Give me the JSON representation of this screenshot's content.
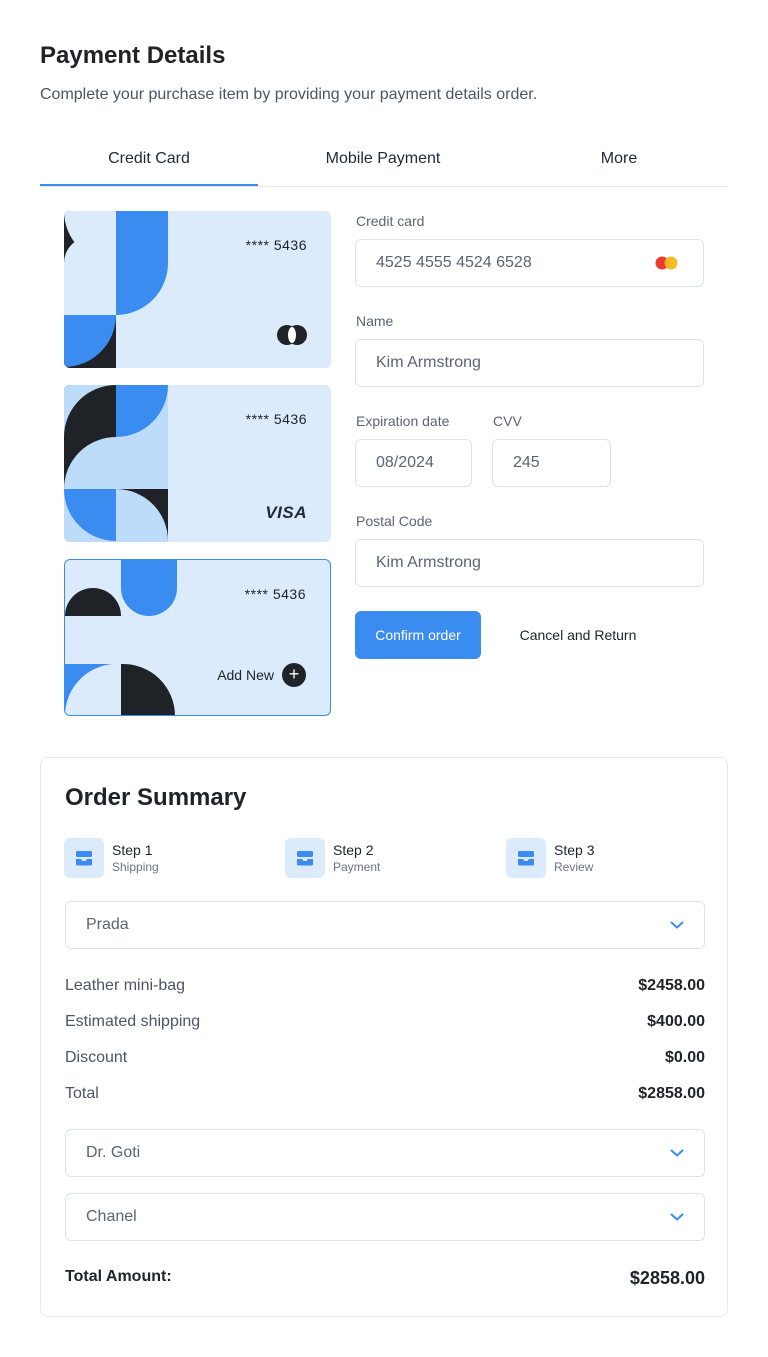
{
  "header": {
    "title": "Payment Details",
    "subtitle": "Complete your purchase item by providing your payment details order."
  },
  "tabs": [
    {
      "label": "Credit Card",
      "active": true
    },
    {
      "label": "Mobile Payment",
      "active": false
    },
    {
      "label": "More",
      "active": false
    }
  ],
  "cards": [
    {
      "number": "****  5436",
      "brand": "mastercard"
    },
    {
      "number": "****  5436",
      "brand": "VISA"
    },
    {
      "number": "****  5436",
      "add_new_label": "Add New"
    }
  ],
  "form": {
    "credit_card_label": "Credit card",
    "credit_card_value": "4525 4555 4524 6528",
    "name_label": "Name",
    "name_value": "Kim Armstrong",
    "expiration_label": "Expiration date",
    "expiration_value": "08/2024",
    "cvv_label": "CVV",
    "cvv_value": "245",
    "postal_label": "Postal Code",
    "postal_value": "Kim Armstrong",
    "confirm_label": "Confirm order",
    "cancel_label": "Cancel and Return"
  },
  "summary": {
    "title": "Order Summary",
    "steps": [
      {
        "title": "Step 1",
        "sub": "Shipping"
      },
      {
        "title": "Step 2",
        "sub": "Payment"
      },
      {
        "title": "Step 3",
        "sub": "Review"
      }
    ],
    "select_1": "Prada",
    "lines": [
      {
        "label": "Leather mini-bag",
        "value": "$2458.00"
      },
      {
        "label": "Estimated shipping",
        "value": "$400.00"
      },
      {
        "label": "Discount",
        "value": "$0.00"
      },
      {
        "label": "Total",
        "value": "$2858.00"
      }
    ],
    "select_2": "Dr. Goti",
    "select_3": "Chanel",
    "total_label": "Total Amount:",
    "total_value": "$2858.00"
  },
  "colors": {
    "accent": "#3b8cf0",
    "card_bg": "#dcebfb",
    "dark": "#1f2328"
  }
}
